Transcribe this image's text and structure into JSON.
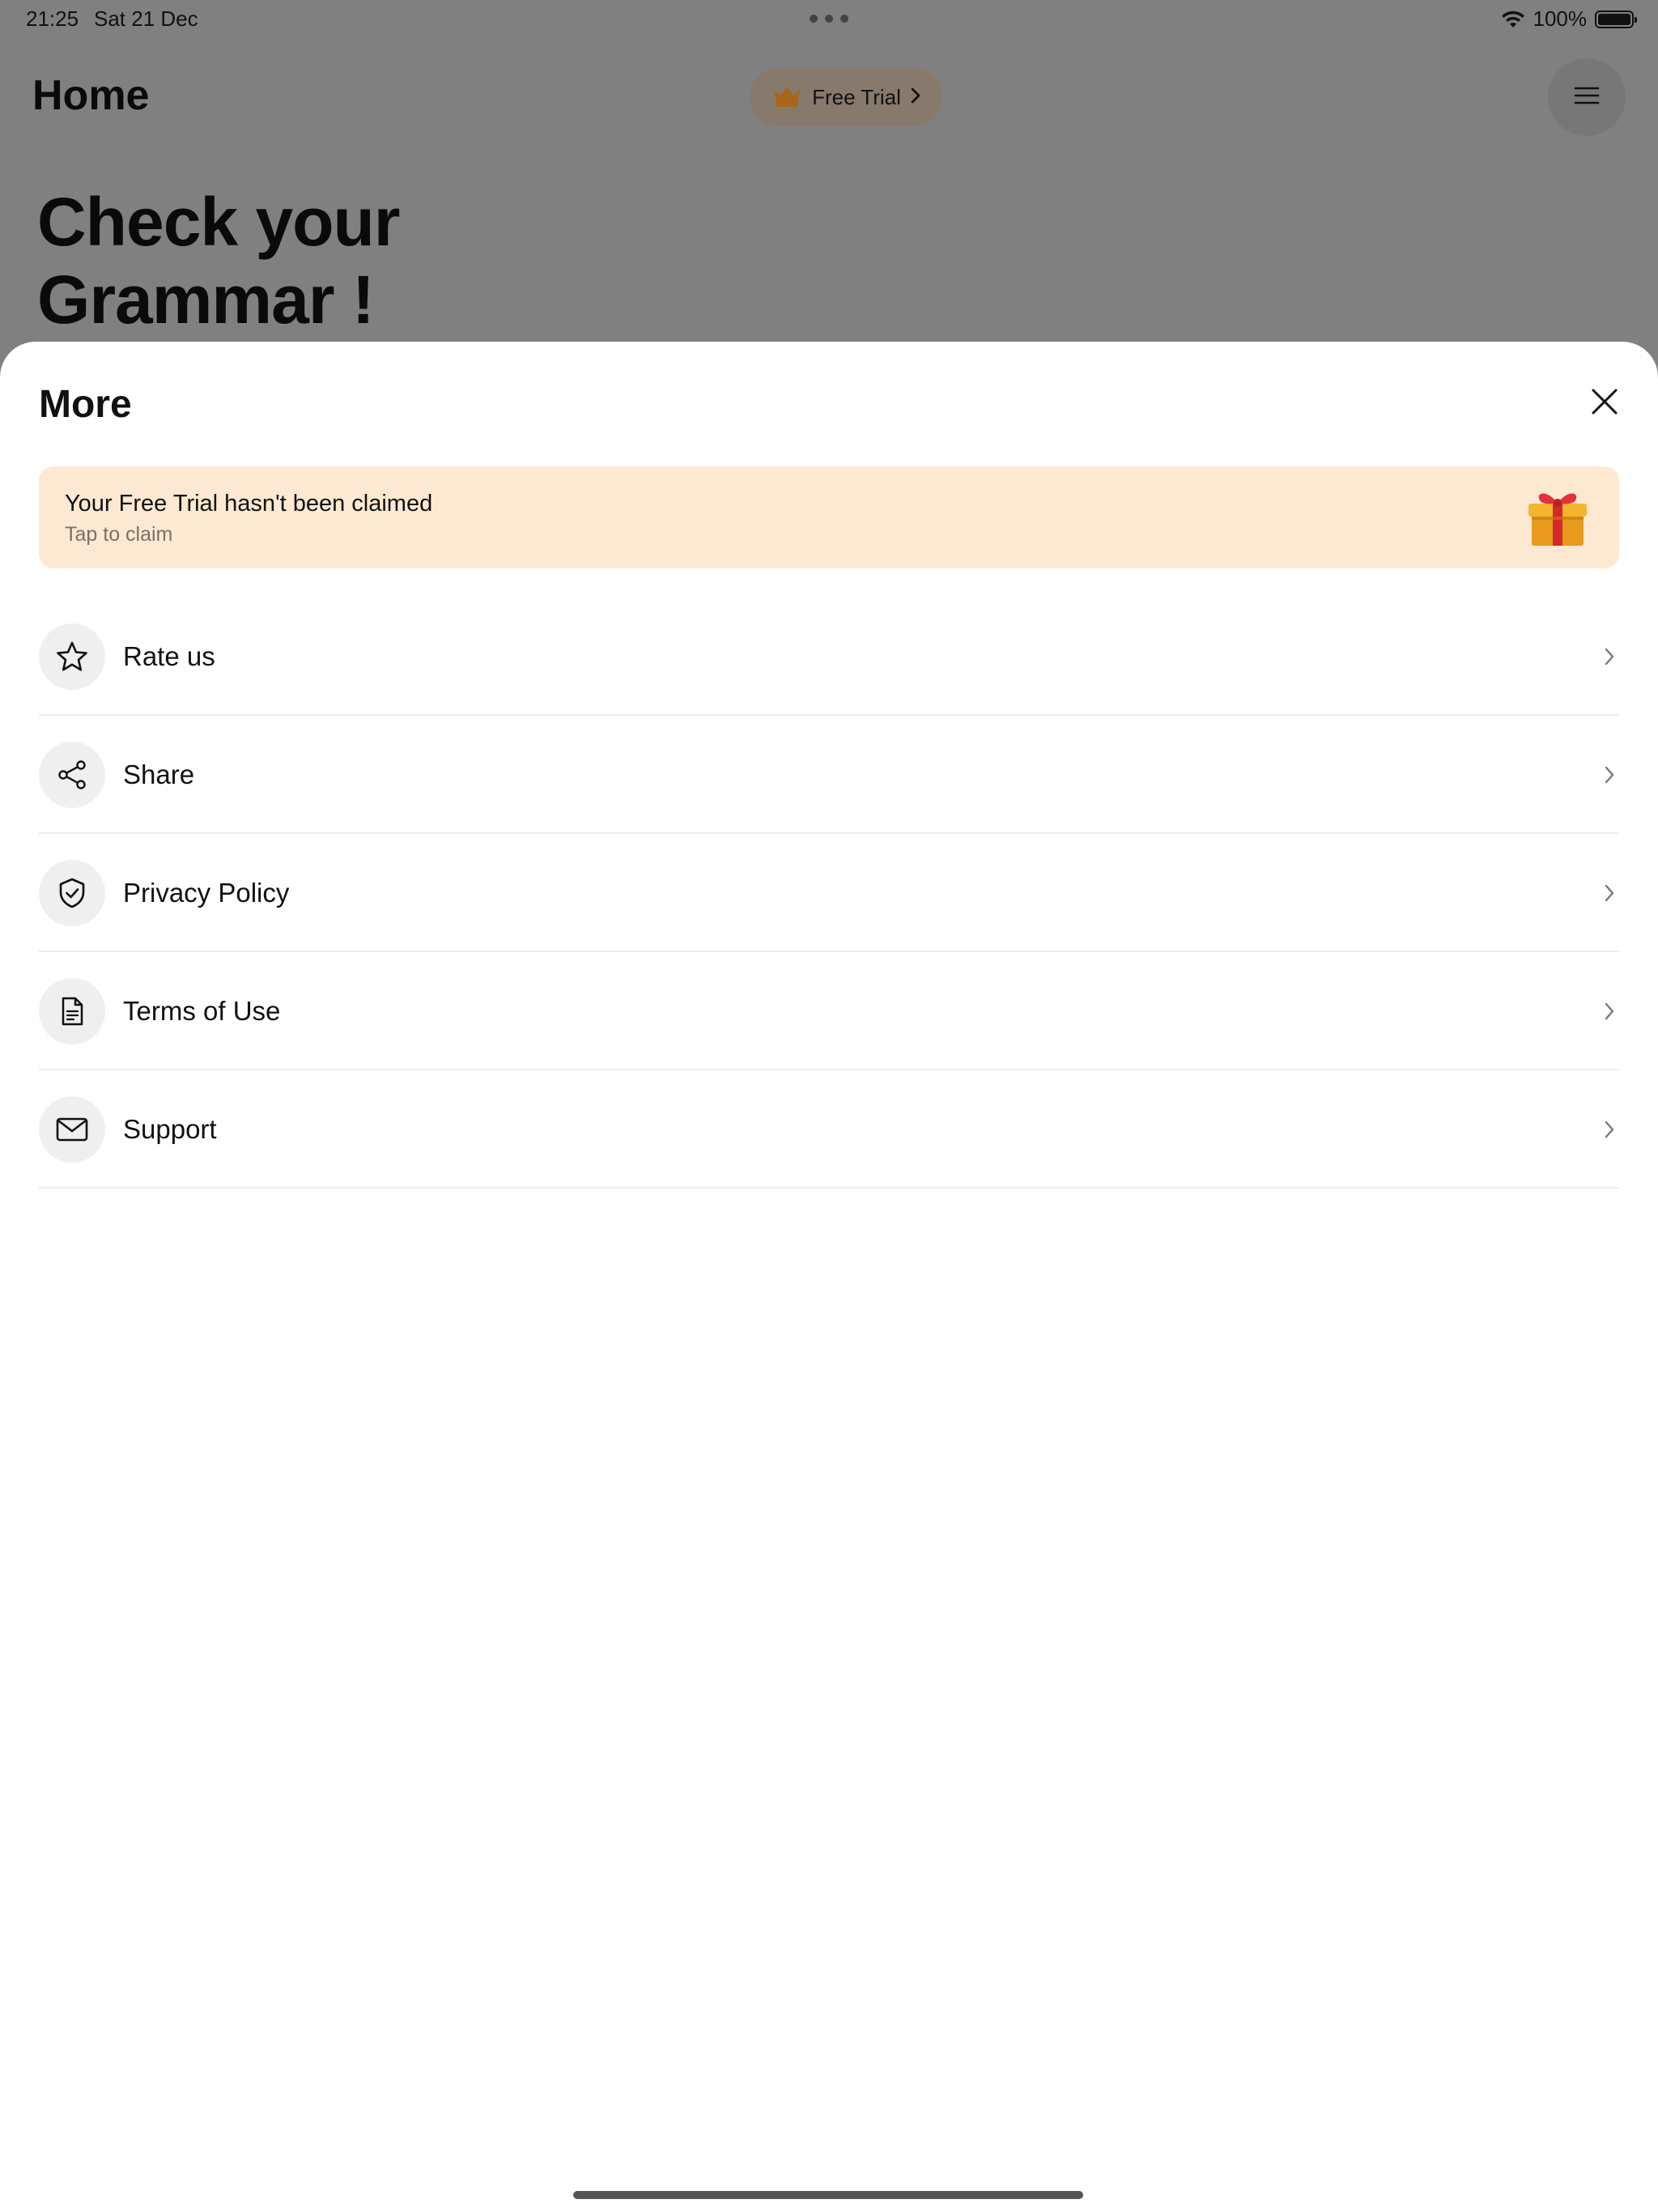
{
  "status_bar": {
    "time": "21:25",
    "date": "Sat 21 Dec",
    "battery": "100%"
  },
  "background": {
    "title": "Home",
    "trial_button": "Free Trial",
    "hero_line_1": "Check your",
    "hero_line_2": "Grammar !"
  },
  "sheet": {
    "title": "More",
    "banner": {
      "title": "Your Free Trial hasn't been claimed",
      "subtitle": "Tap to claim"
    },
    "items": [
      {
        "label": "Rate us",
        "icon": "star-icon"
      },
      {
        "label": "Share",
        "icon": "share-icon"
      },
      {
        "label": "Privacy Policy",
        "icon": "shield-check-icon"
      },
      {
        "label": "Terms of Use",
        "icon": "document-icon"
      },
      {
        "label": "Support",
        "icon": "envelope-icon"
      }
    ]
  },
  "colors": {
    "scrim": "#808080",
    "banner_bg": "#fde9d1",
    "icon_circle_bg": "#efefef",
    "crown": "#c47a1e"
  }
}
